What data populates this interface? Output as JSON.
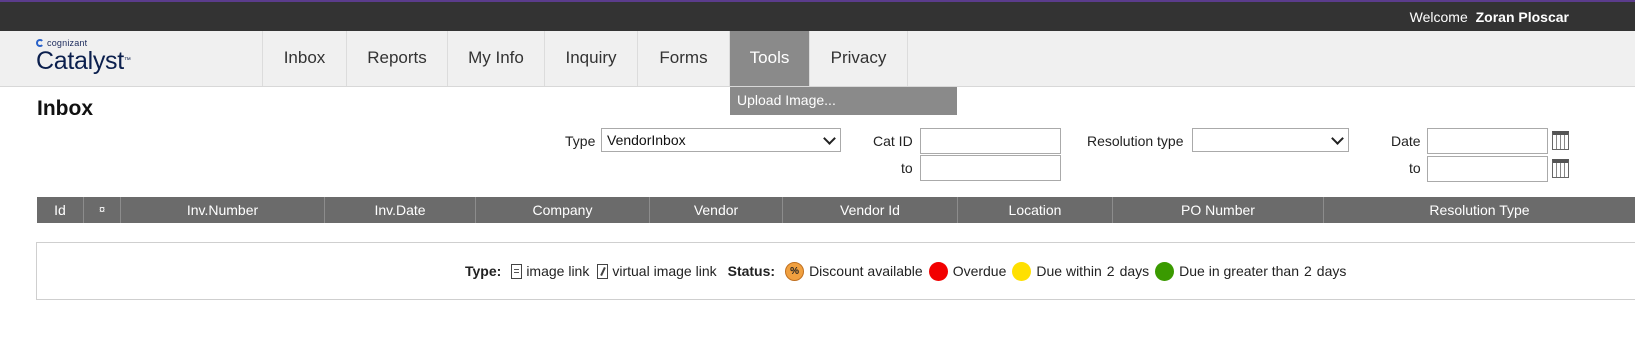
{
  "header": {
    "welcome_label": "Welcome",
    "user_name": "Zoran Ploscar"
  },
  "logo": {
    "company": "cognizant",
    "product": "Catalyst"
  },
  "nav": {
    "items": [
      {
        "label": "Inbox"
      },
      {
        "label": "Reports"
      },
      {
        "label": "My Info"
      },
      {
        "label": "Inquiry"
      },
      {
        "label": "Forms"
      },
      {
        "label": "Tools",
        "active": true
      },
      {
        "label": "Privacy"
      }
    ],
    "dropdown": {
      "items": [
        {
          "label": "Upload Image..."
        }
      ]
    }
  },
  "page": {
    "title": "Inbox"
  },
  "filters": {
    "type_label": "Type",
    "type_value": "VendorInbox",
    "cat_id_label": "Cat ID",
    "to_label": "to",
    "resolution_type_label": "Resolution type",
    "resolution_type_value": "",
    "date_label": "Date",
    "date_to_label": "to"
  },
  "table": {
    "columns": [
      "Id",
      "¤",
      "Inv.Number",
      "Inv.Date",
      "Company",
      "Vendor",
      "Vendor Id",
      "Location",
      "PO Number",
      "Resolution Type"
    ]
  },
  "legend": {
    "type_label": "Type:",
    "image_link": "image link",
    "virtual_image_link": "virtual image link",
    "status_label": "Status:",
    "discount_symbol": "%",
    "discount": "Discount available",
    "overdue": "Overdue",
    "due_within": "Due within",
    "due_within_days": "2",
    "days": "days",
    "due_greater": "Due in greater than",
    "due_greater_days": "2",
    "days2": "days"
  },
  "colors": {
    "topbar": "#333333",
    "accent_strip": "#5b3c8c",
    "active_tab": "#8a8a8a",
    "table_header": "#6b6b6b",
    "status_discount": "#f0a040",
    "status_overdue": "#f20000",
    "status_due_within": "#ffe000",
    "status_due_greater": "#3a9a00"
  }
}
